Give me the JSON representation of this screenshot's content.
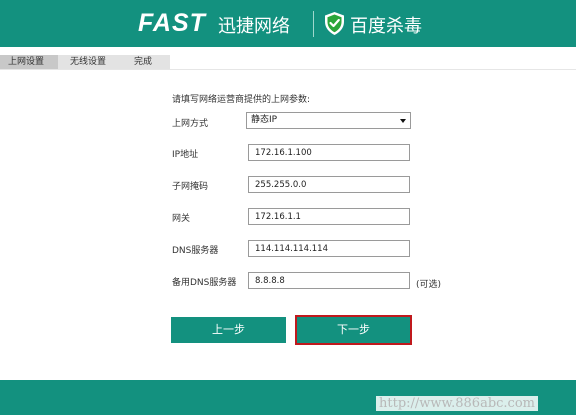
{
  "header": {
    "brand_fast": "FAST",
    "brand_cn": "迅捷网络",
    "partner": "百度杀毒",
    "partner_icon": "shield-check-icon",
    "bg_color": "#13917f"
  },
  "steps": [
    "上网设置",
    "无线设置",
    "完成"
  ],
  "form": {
    "intro": "请填写网络运营商提供的上网参数:",
    "mode_label": "上网方式",
    "mode_value": "静态IP",
    "ip_label": "IP地址",
    "ip_value": "172.16.1.100",
    "mask_label": "子网掩码",
    "mask_value": "255.255.0.0",
    "gateway_label": "网关",
    "gateway_value": "172.16.1.1",
    "dns_label": "DNS服务器",
    "dns_value": "114.114.114.114",
    "dns2_label": "备用DNS服务器",
    "dns2_value": "8.8.8.8",
    "optional_note": "(可选)"
  },
  "buttons": {
    "prev": "上一步",
    "next": "下一步",
    "accent": "#13917f",
    "highlight": "#c0191d"
  },
  "watermark": "http://www.886abc.com"
}
